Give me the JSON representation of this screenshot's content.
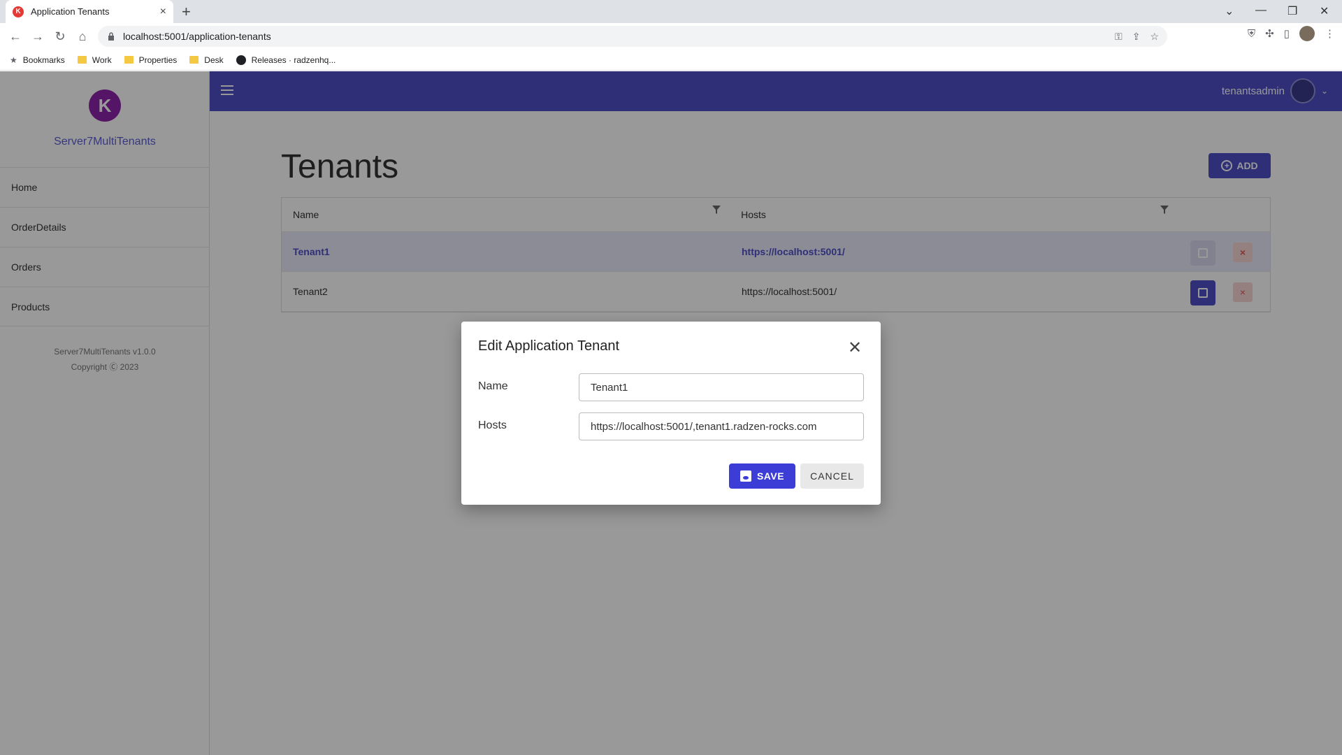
{
  "browser": {
    "tab_title": "Application Tenants",
    "url": "localhost:5001/application-tenants",
    "bookmarks": [
      "Bookmarks",
      "Work",
      "Properties",
      "Desk",
      "Releases · radzenhq..."
    ]
  },
  "app": {
    "name": "Server7MultiTenants",
    "logo_letter": "K",
    "version": "Server7MultiTenants v1.0.0",
    "copyright": "Copyright Ⓒ 2023",
    "nav": [
      "Home",
      "OrderDetails",
      "Orders",
      "Products"
    ],
    "user": "tenantsadmin",
    "accent_color": "#4e4fc5"
  },
  "page": {
    "title": "Tenants",
    "add_label": "ADD",
    "columns": [
      "Name",
      "Hosts"
    ],
    "rows": [
      {
        "name": "Tenant1",
        "hosts": "https://localhost:5001/",
        "selected": true
      },
      {
        "name": "Tenant2",
        "hosts": "https://localhost:5001/",
        "selected": false
      }
    ]
  },
  "dialog": {
    "title": "Edit Application Tenant",
    "name_label": "Name",
    "name_value": "Tenant1",
    "hosts_label": "Hosts",
    "hosts_value": "https://localhost:5001/,tenant1.radzen-rocks.com",
    "save_label": "SAVE",
    "cancel_label": "CANCEL"
  }
}
